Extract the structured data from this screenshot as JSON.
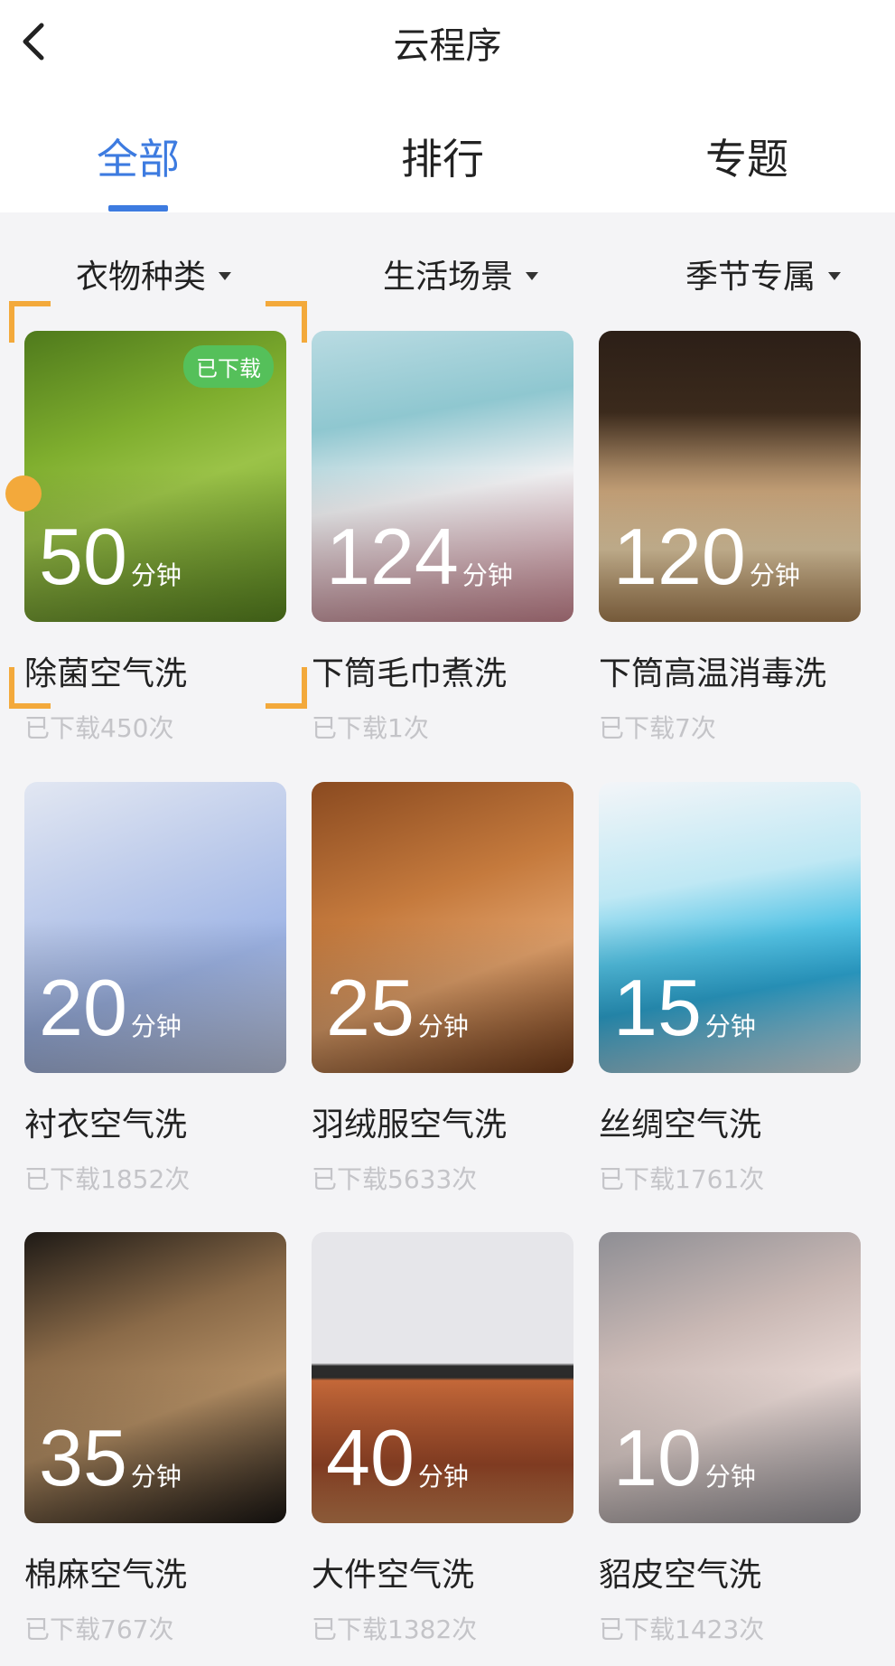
{
  "header": {
    "title": "云程序",
    "tabs": [
      {
        "label": "全部",
        "active": true
      },
      {
        "label": "排行",
        "active": false
      },
      {
        "label": "专题",
        "active": false
      }
    ]
  },
  "filters": [
    {
      "label": "衣物种类"
    },
    {
      "label": "生活场景"
    },
    {
      "label": "季节专属"
    }
  ],
  "colors": {
    "accent": "#3d7be0",
    "badge": "#55c05a",
    "focus": "#f3a93b"
  },
  "programs": [
    {
      "minutes": "50",
      "unit": "分钟",
      "name": "除菌空气洗",
      "downloads": "已下载450次",
      "badge": "已下载"
    },
    {
      "minutes": "124",
      "unit": "分钟",
      "name": "下筒毛巾煮洗",
      "downloads": "已下载1次"
    },
    {
      "minutes": "120",
      "unit": "分钟",
      "name": "下筒高温消毒洗",
      "downloads": "已下载7次"
    },
    {
      "minutes": "20",
      "unit": "分钟",
      "name": "衬衣空气洗",
      "downloads": "已下载1852次"
    },
    {
      "minutes": "25",
      "unit": "分钟",
      "name": "羽绒服空气洗",
      "downloads": "已下载5633次"
    },
    {
      "minutes": "15",
      "unit": "分钟",
      "name": "丝绸空气洗",
      "downloads": "已下载1761次"
    },
    {
      "minutes": "35",
      "unit": "分钟",
      "name": "棉麻空气洗",
      "downloads": "已下载767次"
    },
    {
      "minutes": "40",
      "unit": "分钟",
      "name": "大件空气洗",
      "downloads": "已下载1382次"
    },
    {
      "minutes": "10",
      "unit": "分钟",
      "name": "貂皮空气洗",
      "downloads": "已下载1423次"
    }
  ]
}
